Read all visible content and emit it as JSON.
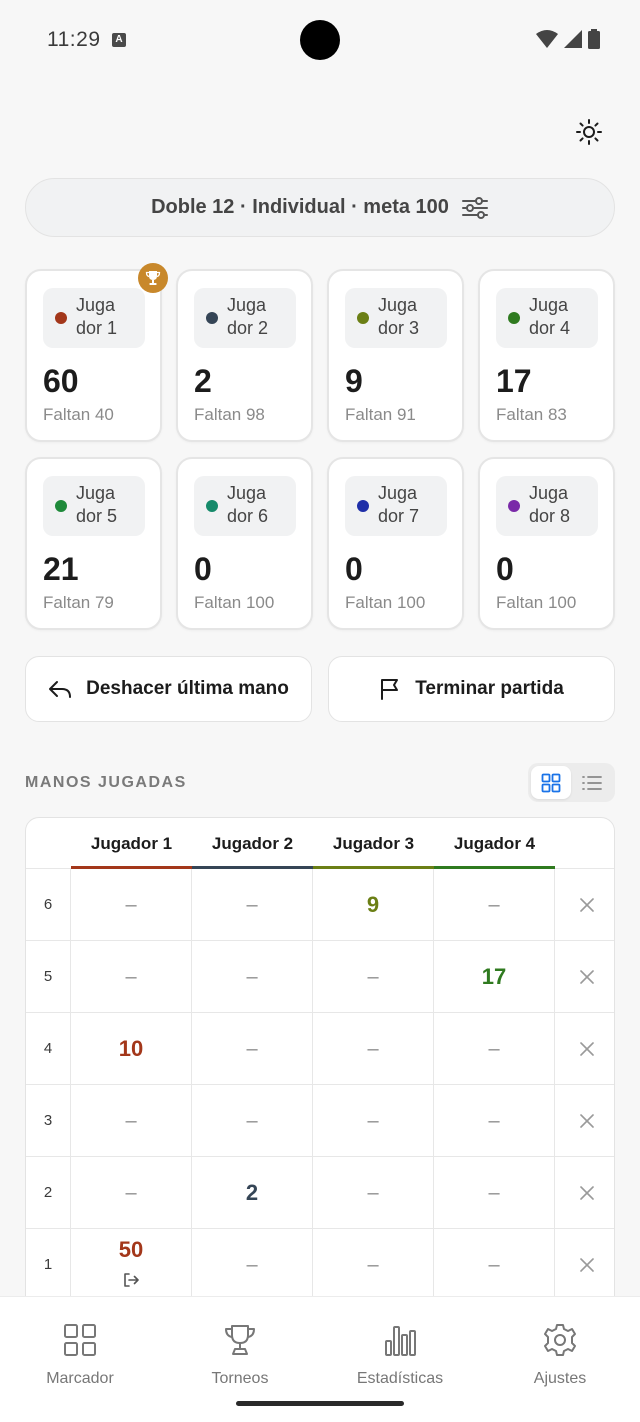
{
  "status": {
    "time": "11:29",
    "badge": "A"
  },
  "config": {
    "summary": "Doble 12 · Individual · meta 100"
  },
  "players": [
    {
      "name_line1": "Juga",
      "name_line2": "dor 1",
      "score": "60",
      "remaining": "Faltan 40",
      "color": "#a3371a",
      "leader": true
    },
    {
      "name_line1": "Juga",
      "name_line2": "dor 2",
      "score": "2",
      "remaining": "Faltan 98",
      "color": "#354556",
      "leader": false
    },
    {
      "name_line1": "Juga",
      "name_line2": "dor 3",
      "score": "9",
      "remaining": "Faltan 91",
      "color": "#6b7f15",
      "leader": false
    },
    {
      "name_line1": "Juga",
      "name_line2": "dor 4",
      "score": "17",
      "remaining": "Faltan 83",
      "color": "#2f7a1f",
      "leader": false
    },
    {
      "name_line1": "Juga",
      "name_line2": "dor 5",
      "score": "21",
      "remaining": "Faltan 79",
      "color": "#1f8a3a",
      "leader": false
    },
    {
      "name_line1": "Juga",
      "name_line2": "dor 6",
      "score": "0",
      "remaining": "Faltan 100",
      "color": "#168a6a",
      "leader": false
    },
    {
      "name_line1": "Juga",
      "name_line2": "dor 7",
      "score": "0",
      "remaining": "Faltan 100",
      "color": "#1f2fa8",
      "leader": false
    },
    {
      "name_line1": "Juga",
      "name_line2": "dor 8",
      "score": "0",
      "remaining": "Faltan 100",
      "color": "#7a2aa8",
      "leader": false
    }
  ],
  "actions": {
    "undo_label": "Deshacer última mano",
    "finish_label": "Terminar partida"
  },
  "hands": {
    "title": "MANOS JUGADAS",
    "columns": [
      {
        "label": "Jugador 1",
        "color": "#a3371a"
      },
      {
        "label": "Jugador 2",
        "color": "#354556"
      },
      {
        "label": "Jugador 3",
        "color": "#6b7f15"
      },
      {
        "label": "Jugador 4",
        "color": "#2f7a1f"
      }
    ],
    "dash": "–",
    "rows": [
      {
        "number": "6",
        "values": [
          "",
          "",
          "9",
          ""
        ]
      },
      {
        "number": "5",
        "values": [
          "",
          "",
          "",
          "17"
        ]
      },
      {
        "number": "4",
        "values": [
          "10",
          "",
          "",
          ""
        ]
      },
      {
        "number": "3",
        "values": [
          "",
          "",
          "",
          ""
        ]
      },
      {
        "number": "2",
        "values": [
          "",
          "2",
          "",
          ""
        ]
      },
      {
        "number": "1",
        "values": [
          "50",
          "",
          "",
          ""
        ],
        "exit_marker_column": 0
      }
    ]
  },
  "nav": [
    {
      "label": "Marcador",
      "icon": "grid-icon"
    },
    {
      "label": "Torneos",
      "icon": "trophy-icon"
    },
    {
      "label": "Estadísticas",
      "icon": "bar-chart-icon"
    },
    {
      "label": "Ajustes",
      "icon": "gear-icon"
    }
  ],
  "colors": {
    "accent": "#1a73e8",
    "leader_badge": "#c8882b"
  }
}
